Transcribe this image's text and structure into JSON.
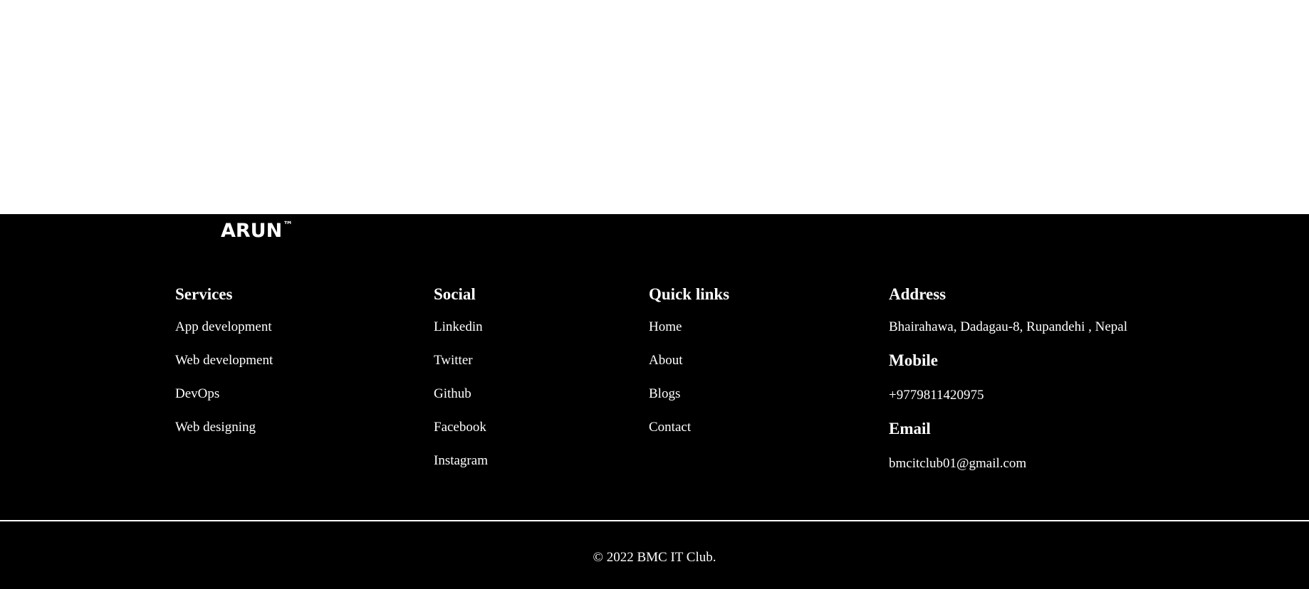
{
  "brand": {
    "name": "ARUN",
    "trademark": "™"
  },
  "services": {
    "heading": "Services",
    "items": [
      "App development",
      "Web development",
      "DevOps",
      "Web designing"
    ]
  },
  "social": {
    "heading": "Social",
    "items": [
      "Linkedin",
      "Twitter",
      "Github",
      "Facebook",
      "Instagram"
    ]
  },
  "quick_links": {
    "heading": "Quick links",
    "items": [
      "Home",
      "About",
      "Blogs",
      "Contact"
    ]
  },
  "contact": {
    "address_heading": "Address",
    "address": "Bhairahawa, Dadagau-8, Rupandehi , Nepal",
    "mobile_heading": "Mobile",
    "mobile": "+9779811420975",
    "email_heading": "Email",
    "email": "bmcitclub01@gmail.com"
  },
  "copyright": "© 2022 BMC IT Club.",
  "colors": {
    "footer_bg": "#000000",
    "page_bg": "#ffffff",
    "text": "#ffffff"
  }
}
